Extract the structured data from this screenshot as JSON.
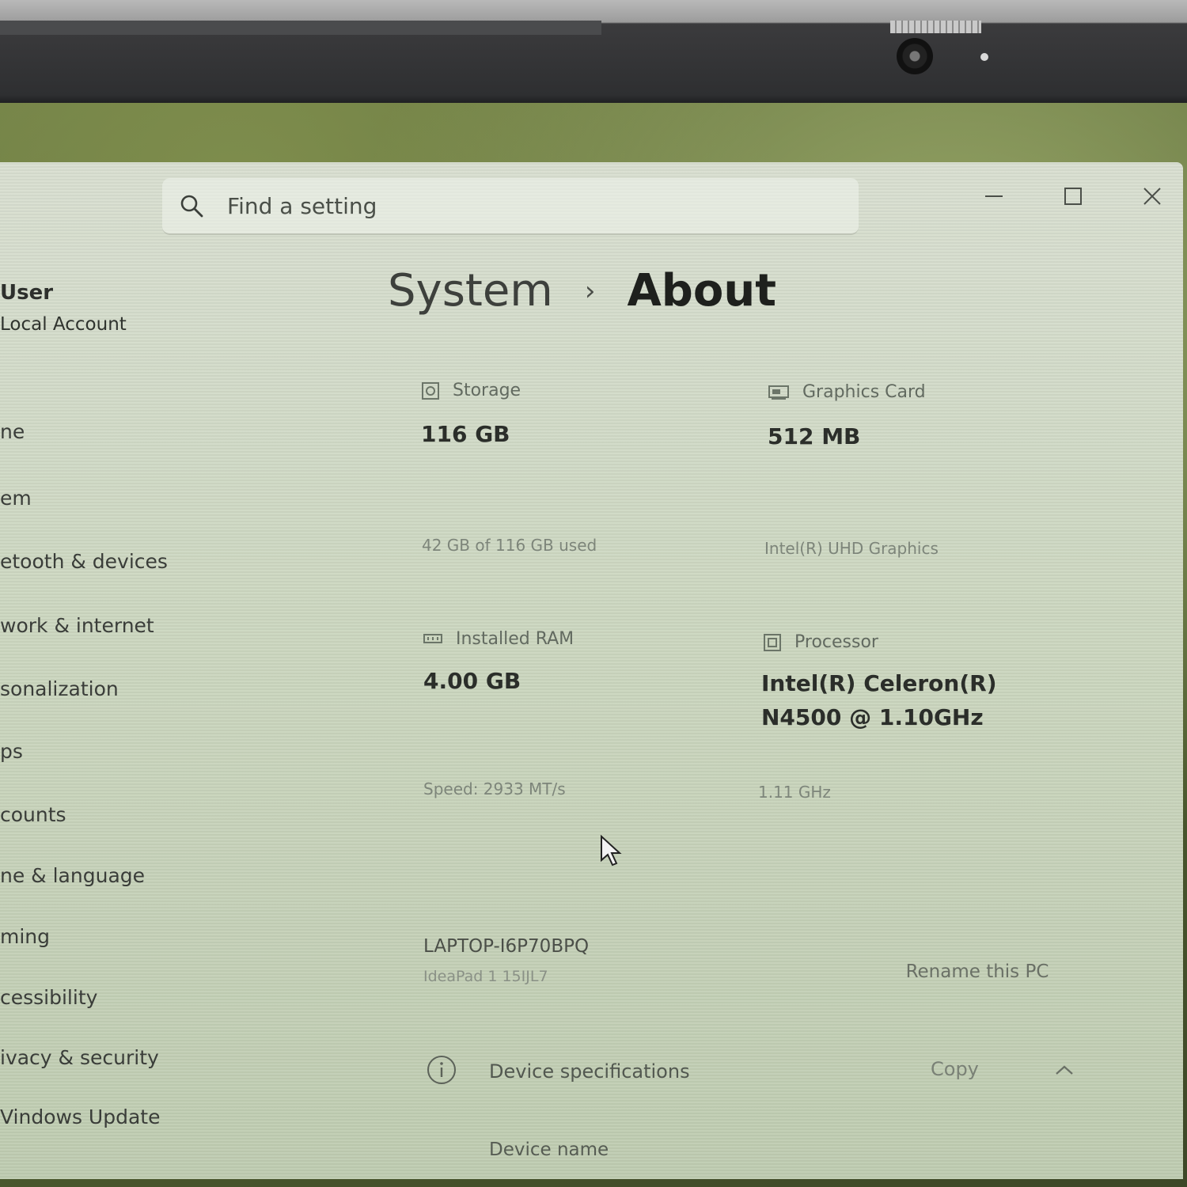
{
  "search": {
    "placeholder": "Find a setting"
  },
  "account": {
    "name": "User",
    "type": "Local Account"
  },
  "sidebar": {
    "items": [
      {
        "label": "ne"
      },
      {
        "label": "em"
      },
      {
        "label": "etooth & devices"
      },
      {
        "label": "work & internet"
      },
      {
        "label": "sonalization"
      },
      {
        "label": "ps"
      },
      {
        "label": "counts"
      },
      {
        "label": "ne & language"
      },
      {
        "label": "ming"
      },
      {
        "label": "cessibility"
      },
      {
        "label": "ivacy & security"
      },
      {
        "label": "Vindows Update"
      }
    ]
  },
  "breadcrumb": {
    "parent": "System",
    "separator": "›",
    "current": "About"
  },
  "specs": {
    "storage": {
      "label": "Storage",
      "value": "116 GB",
      "detail": "42 GB of 116 GB used"
    },
    "graphics": {
      "label": "Graphics Card",
      "value": "512 MB",
      "detail": "Intel(R) UHD Graphics"
    },
    "ram": {
      "label": "Installed RAM",
      "value": "4.00 GB",
      "detail": "Speed: 2933 MT/s"
    },
    "processor": {
      "label": "Processor",
      "value_line1": "Intel(R) Celeron(R)",
      "value_line2": "N4500 @ 1.10GHz",
      "detail": "1.11 GHz"
    }
  },
  "device": {
    "pc_name": "LAPTOP-I6P70BPQ",
    "model": "IdeaPad 1 15IJL7",
    "rename_label": "Rename this PC"
  },
  "device_specs": {
    "title": "Device specifications",
    "copy_label": "Copy",
    "first_field": "Device name"
  },
  "icons": [
    "search-icon",
    "minimize-icon",
    "maximize-icon",
    "close-icon",
    "storage-icon",
    "graphics-card-icon",
    "ram-icon",
    "processor-icon",
    "info-icon",
    "chevron-up-icon",
    "cursor-icon"
  ]
}
